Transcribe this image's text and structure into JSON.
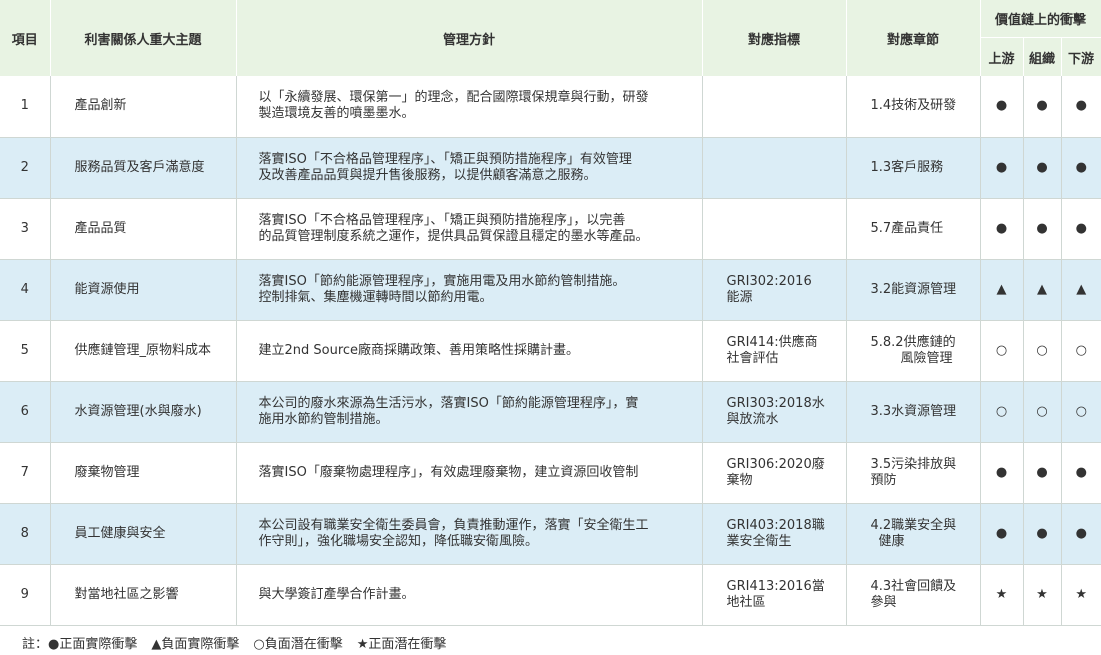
{
  "headers": {
    "no": "項目",
    "topic": "利害關係人重大主題",
    "policy": "管理方針",
    "indicator": "對應指標",
    "chapter": "對應章節",
    "value_chain": "價值鏈上的衝擊",
    "upstream": "上游",
    "organization": "組織",
    "downstream": "下游"
  },
  "rows": [
    {
      "no": "1",
      "topic": "產品創新",
      "policy_lines": [
        "以「永續發展、環保第一」的理念，配合國際環保規章與行動，研發",
        "製造環境友善的噴墨墨水。"
      ],
      "indicator_lines": [],
      "chapter_lines": [
        "1.4技術及研發"
      ],
      "up": "●",
      "org": "●",
      "down": "●"
    },
    {
      "no": "2",
      "topic": "服務品質及客戶滿意度",
      "policy_lines": [
        "落實ISO「不合格品管理程序」、「矯正與預防措施程序」有效管理",
        "及改善產品品質與提升售後服務，以提供顧客滿意之服務。"
      ],
      "indicator_lines": [],
      "chapter_lines": [
        "1.3客戶服務"
      ],
      "up": "●",
      "org": "●",
      "down": "●"
    },
    {
      "no": "3",
      "topic": "產品品質",
      "policy_lines": [
        "落實ISO「不合格品管理程序」、「矯正與預防措施程序」，以完善",
        "的品質管理制度系統之運作，提供具品質保證且穩定的墨水等產品。"
      ],
      "indicator_lines": [],
      "chapter_lines": [
        "5.7產品責任"
      ],
      "up": "●",
      "org": "●",
      "down": "●"
    },
    {
      "no": "4",
      "topic": "能資源使用",
      "policy_lines": [
        "落實ISO「節約能源管理程序」，實施用電及用水節約管制措施。",
        "控制排氣、集塵機運轉時間以節約用電。"
      ],
      "indicator_lines": [
        "GRI302:2016",
        "能源"
      ],
      "chapter_lines": [
        "3.2能資源管理"
      ],
      "up": "▲",
      "org": "▲",
      "down": "▲"
    },
    {
      "no": "5",
      "topic": "供應鏈管理_原物料成本",
      "policy_lines": [
        "建立2nd Source廠商採購政策、善用策略性採購計畫。"
      ],
      "indicator_lines": [
        "GRI414:供應商",
        "社會評估"
      ],
      "chapter_lines": [
        "5.8.2供應鏈的",
        "風險管理"
      ],
      "up": "○",
      "org": "○",
      "down": "○"
    },
    {
      "no": "6",
      "topic": "水資源管理(水與廢水)",
      "policy_lines": [
        "本公司的廢水來源為生活污水，落實ISO「節約能源管理程序」，實",
        "施用水節約管制措施。"
      ],
      "indicator_lines": [
        "GRI303:2018水",
        "與放流水"
      ],
      "chapter_lines": [
        "3.3水資源管理"
      ],
      "up": "○",
      "org": "○",
      "down": "○"
    },
    {
      "no": "7",
      "topic": "廢棄物管理",
      "policy_lines": [
        "落實ISO「廢棄物處理程序」，有效處理廢棄物，建立資源回收管制"
      ],
      "indicator_lines": [
        "GRI306:2020廢",
        "棄物"
      ],
      "chapter_lines": [
        "3.5污染排放與",
        "預防"
      ],
      "up": "●",
      "org": "●",
      "down": "●"
    },
    {
      "no": "8",
      "topic": "員工健康與安全",
      "policy_lines": [
        "本公司設有職業安全衛生委員會，負責推動運作，落實「安全衛生工",
        "作守則」，強化職場安全認知，降低職安衛風險。"
      ],
      "indicator_lines": [
        "GRI403:2018職",
        "業安全衛生"
      ],
      "chapter_lines": [
        "4.2職業安全與",
        "健康"
      ],
      "up": "●",
      "org": "●",
      "down": "●"
    },
    {
      "no": "9",
      "topic": "對當地社區之影響",
      "policy_lines": [
        "與大學簽訂產學合作計畫。"
      ],
      "indicator_lines": [
        "GRI413:2016當",
        "地社區"
      ],
      "chapter_lines": [
        "4.3社會回饋及",
        "參與"
      ],
      "up": "★",
      "org": "★",
      "down": "★"
    }
  ],
  "footnote": {
    "lead": "註：",
    "items": [
      "●正面實際衝擊",
      "▲負面實際衝擊",
      "○負面潛在衝擊",
      "★正面潛在衝擊"
    ]
  }
}
